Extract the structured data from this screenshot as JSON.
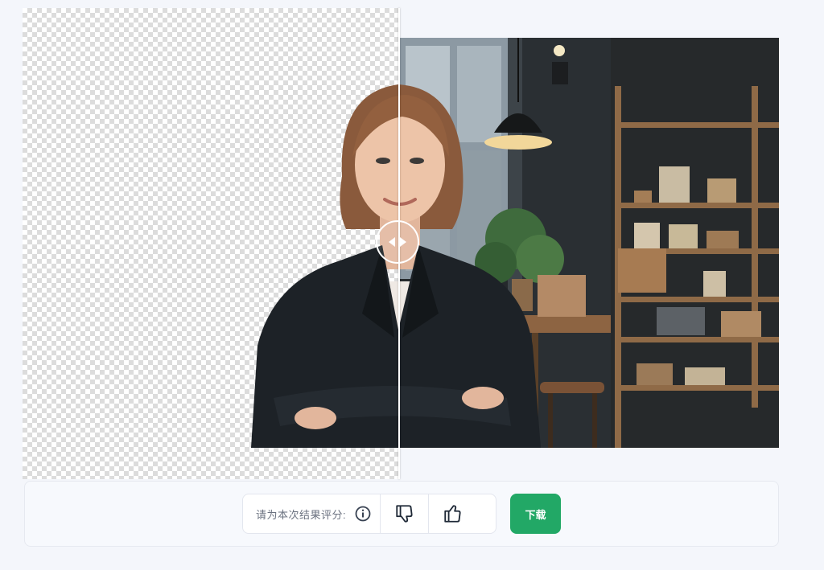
{
  "comparison": {
    "left_view": "transparent-background",
    "right_view": "original-photo",
    "slider_position": 0.5
  },
  "rating": {
    "prompt": "请为本次结果评分:",
    "info_icon": "info-icon",
    "dislike_icon": "thumbs-down-icon",
    "like_icon": "thumbs-up-icon"
  },
  "actions": {
    "download_label": "下载",
    "download_color": "#22a866"
  }
}
